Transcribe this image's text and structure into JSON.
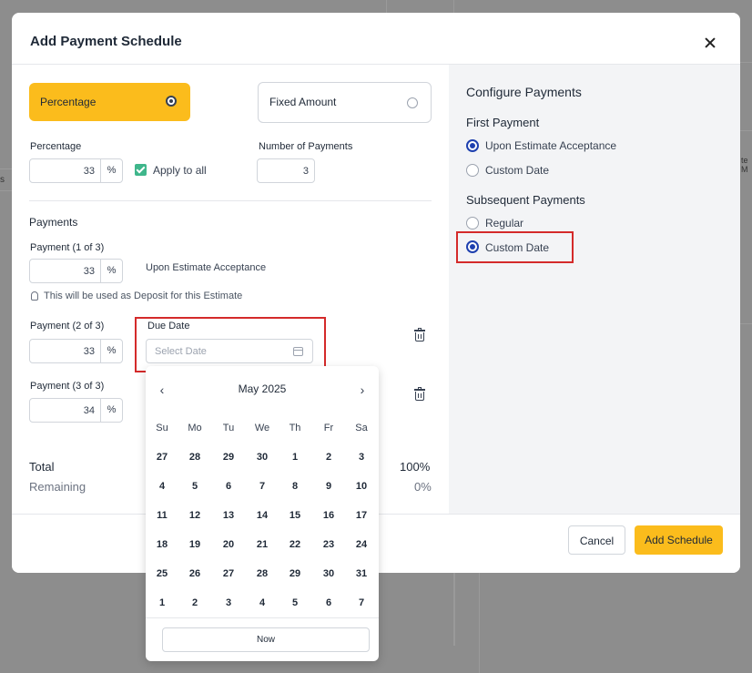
{
  "modal": {
    "title": "Add Payment Schedule"
  },
  "type_options": {
    "percentage": "Percentage",
    "fixed_amount": "Fixed Amount",
    "selected": "percentage"
  },
  "form": {
    "percentage_label": "Percentage",
    "percentage_value": "33",
    "pct_symbol": "%",
    "apply_to_all": "Apply to all",
    "number_of_payments_label": "Number of Payments",
    "number_of_payments_value": "3"
  },
  "payments": {
    "heading": "Payments",
    "items": [
      {
        "label": "Payment (1 of 3)",
        "value": "33",
        "due": "Upon Estimate Acceptance",
        "note": "This will be used as Deposit for this Estimate"
      },
      {
        "label": "Payment (2 of 3)",
        "value": "33",
        "due_label": "Due Date",
        "due_placeholder": "Select Date"
      },
      {
        "label": "Payment (3 of 3)",
        "value": "34"
      }
    ]
  },
  "totals": {
    "total_label": "Total",
    "total_value": "100%",
    "remaining_label": "Remaining",
    "remaining_value": "0%"
  },
  "configure": {
    "heading": "Configure Payments",
    "first_payment": {
      "heading": "First Payment",
      "options": [
        "Upon Estimate Acceptance",
        "Custom Date"
      ],
      "selected": "Upon Estimate Acceptance"
    },
    "subsequent_payments": {
      "heading": "Subsequent Payments",
      "options": [
        "Regular",
        "Custom Date"
      ],
      "selected": "Custom Date"
    }
  },
  "calendar": {
    "month_label": "May 2025",
    "prev_icon": "‹",
    "next_icon": "›",
    "weekdays": [
      "Su",
      "Mo",
      "Tu",
      "We",
      "Th",
      "Fr",
      "Sa"
    ],
    "weeks": [
      [
        "27",
        "28",
        "29",
        "30",
        "1",
        "2",
        "3"
      ],
      [
        "4",
        "5",
        "6",
        "7",
        "8",
        "9",
        "10"
      ],
      [
        "11",
        "12",
        "13",
        "14",
        "15",
        "16",
        "17"
      ],
      [
        "18",
        "19",
        "20",
        "21",
        "22",
        "23",
        "24"
      ],
      [
        "25",
        "26",
        "27",
        "28",
        "29",
        "30",
        "31"
      ],
      [
        "1",
        "2",
        "3",
        "4",
        "5",
        "6",
        "7"
      ]
    ],
    "now_label": "Now"
  },
  "footer": {
    "cancel_label": "Cancel",
    "add_label": "Add Schedule"
  },
  "background": {
    "frag_left": "s",
    "frag_right": "te M"
  },
  "colors": {
    "accent": "#fbbc1c",
    "highlight": "#d42a2a",
    "radio_selected": "#1e40af",
    "checkbox": "#3fb68b"
  }
}
